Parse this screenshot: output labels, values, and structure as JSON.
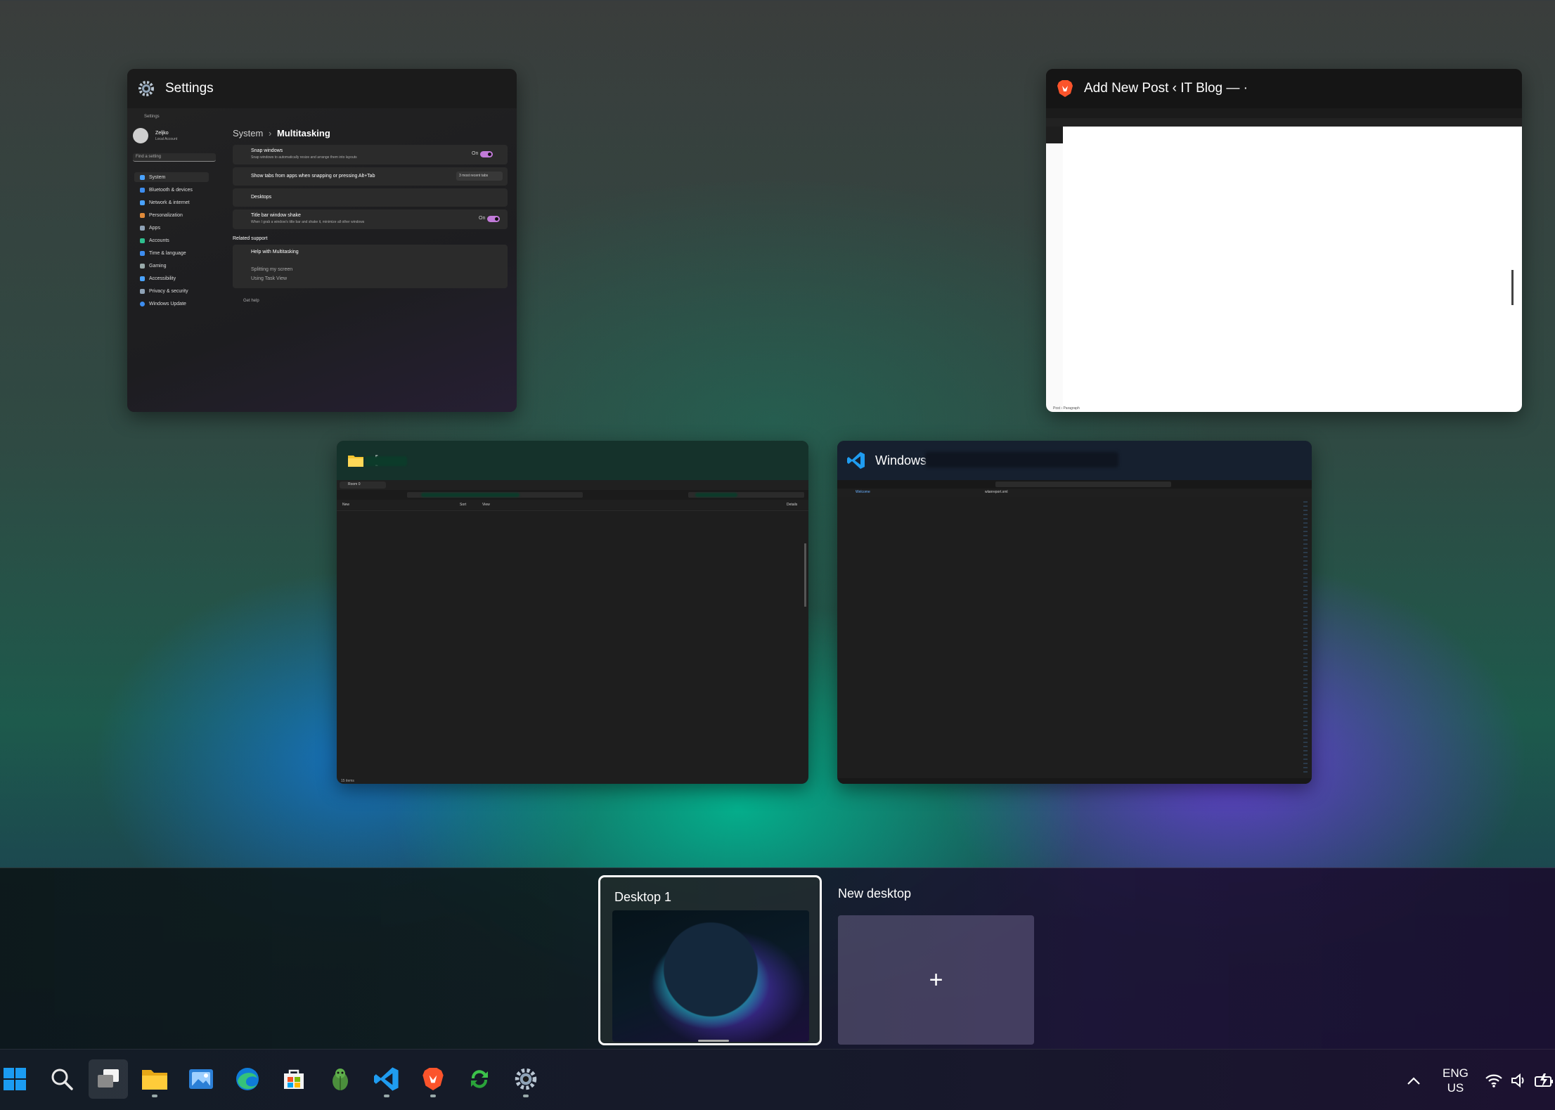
{
  "windows": {
    "settings": {
      "title": "Settings",
      "app_label": "Settings",
      "user_name": "Zeljko",
      "user_sub": "Local Account",
      "search_placeholder": "Find a setting",
      "breadcrumb_parent": "System",
      "breadcrumb_sep": "›",
      "breadcrumb_current": "Multitasking",
      "sidebar": [
        "System",
        "Bluetooth & devices",
        "Network & internet",
        "Personalization",
        "Apps",
        "Accounts",
        "Time & language",
        "Gaming",
        "Accessibility",
        "Privacy & security",
        "Windows Update"
      ],
      "rows": {
        "snap_title": "Snap windows",
        "snap_sub": "Snap windows to automatically resize and arrange them into layouts",
        "snap_state": "On",
        "tabs_title": "Show tabs from apps when snapping or pressing Alt+Tab",
        "tabs_value": "3 most recent tabs",
        "desktops_title": "Desktops",
        "shake_title": "Title bar window shake",
        "shake_sub": "When I grab a window's title bar and shake it, minimize all other windows",
        "shake_state": "On"
      },
      "related_support": "Related support",
      "help_title": "Help with Multitasking",
      "help_links": [
        "Splitting my screen",
        "Using Task View"
      ],
      "get_help": "Get help"
    },
    "browser": {
      "title": "Add New Post ‹ IT Blog — ·",
      "status_left": "Post",
      "status_sep": "›",
      "status_right": "Paragraph"
    },
    "explorer": {
      "title": "[",
      "tab_label": "Room 0",
      "new_label": "New",
      "sort_label": "Sort",
      "view_label": "View",
      "details_label": "Details",
      "status": "15 items"
    },
    "vscode": {
      "title": "Windows",
      "tabs": [
        "Welcome",
        "wlanreport.xml"
      ]
    }
  },
  "desktops": {
    "desktop1": "Desktop 1",
    "new_desktop": "New desktop",
    "plus": "+"
  },
  "taskbar": {
    "icons": [
      "windows-start",
      "search",
      "task-view",
      "file-explorer",
      "photos",
      "edge",
      "store",
      "bug-app",
      "vscode",
      "brave",
      "sync-app",
      "settings"
    ],
    "lang_top": "ENG",
    "lang_bottom": "US",
    "accent": "#0a84ff"
  }
}
